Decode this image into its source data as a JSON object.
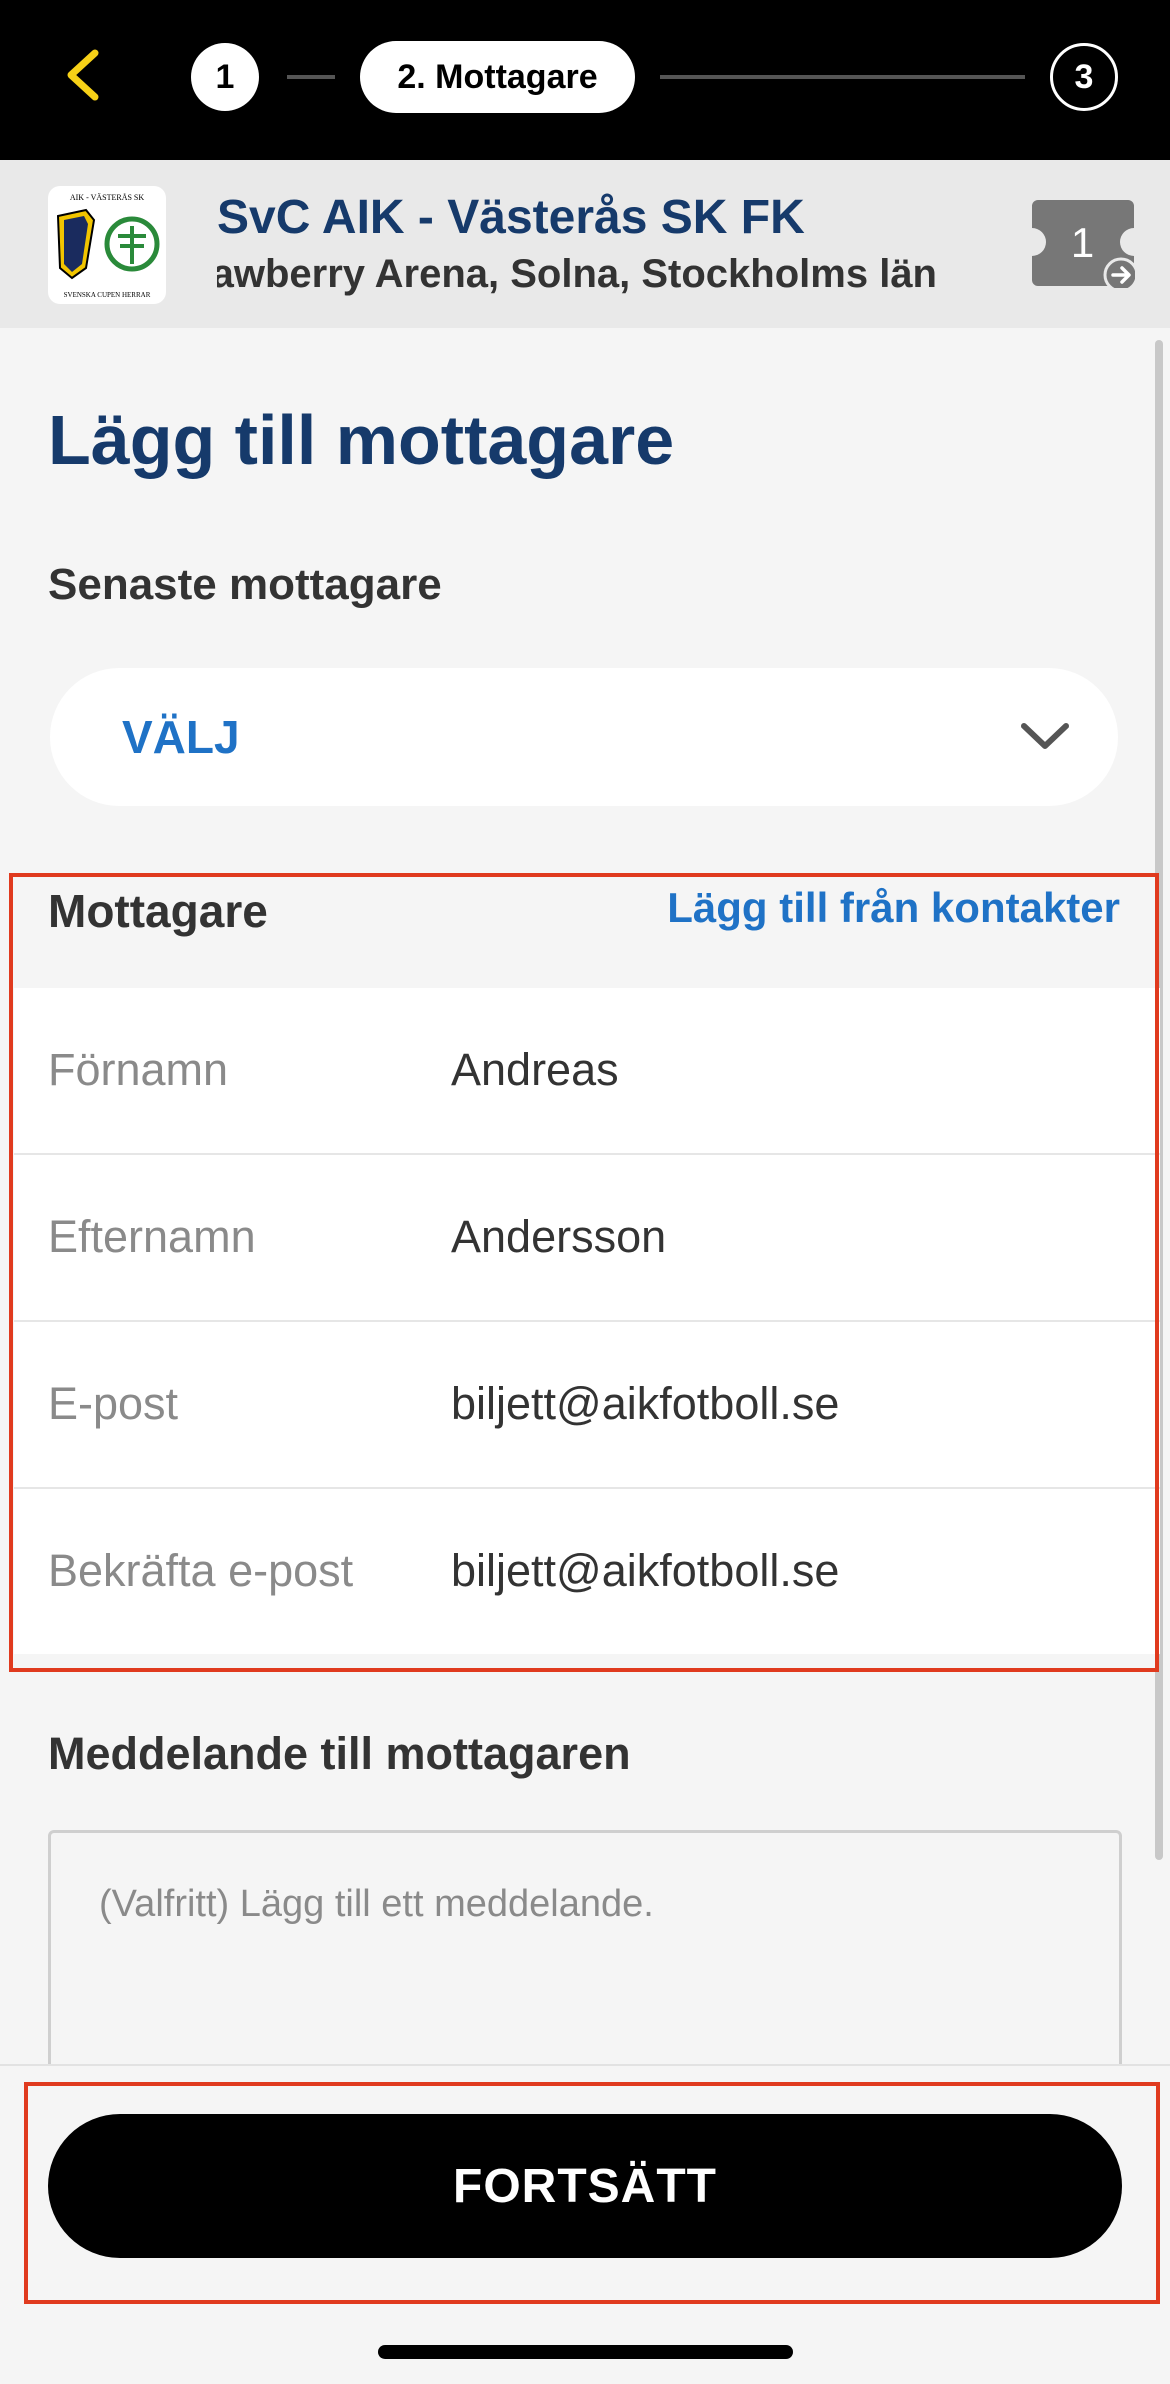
{
  "stepper": {
    "step1": "1",
    "step2": "2. Mottagare",
    "step3": "3"
  },
  "event": {
    "title": "SvC AIK - Västerås SK FK",
    "venue": "Strawberry Arena, Solna, Stockholms län",
    "ticket_count": "1",
    "logo_text_top": "AIK - VÄSTERÅS SK",
    "logo_text_bottom": "SVENSKA CUPEN HERRAR"
  },
  "page": {
    "title": "Lägg till mottagare"
  },
  "recent": {
    "label": "Senaste mottagare",
    "select_value": "VÄLJ"
  },
  "recipient": {
    "header": "Mottagare",
    "contacts_link": "Lägg till från kontakter",
    "fields": [
      {
        "label": "Förnamn",
        "value": "Andreas"
      },
      {
        "label": "Efternamn",
        "value": "Andersson"
      },
      {
        "label": "E-post",
        "value": "biljett@aikfotboll.se"
      },
      {
        "label": "Bekräfta e-post",
        "value": "biljett@aikfotboll.se"
      }
    ]
  },
  "message": {
    "label": "Meddelande till mottagaren",
    "placeholder": "(Valfritt) Lägg till ett meddelande."
  },
  "footer": {
    "continue_label": "FORTSÄTT"
  },
  "colors": {
    "accent_yellow": "#f7d117",
    "navy": "#163a6b",
    "link_blue": "#1f72c6",
    "highlight_red": "#e03a1e"
  }
}
